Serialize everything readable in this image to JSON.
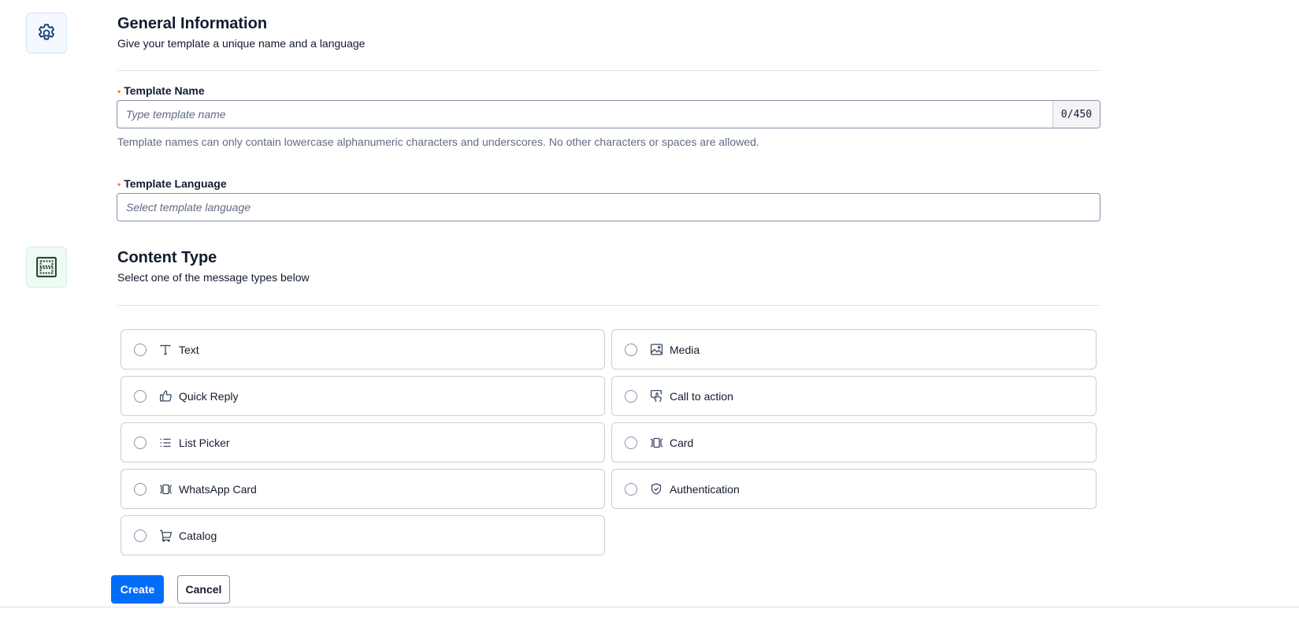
{
  "general": {
    "title": "General Information",
    "subtitle": "Give your template a unique name and a language",
    "icon": "gear-icon"
  },
  "template_name": {
    "required_marker": "•",
    "label": "Template Name",
    "placeholder": "Type template name",
    "value": "",
    "counter": "0/450",
    "help": "Template names can only contain lowercase alphanumeric characters and underscores. No other characters or spaces are allowed."
  },
  "template_language": {
    "required_marker": "•",
    "label": "Template Language",
    "placeholder": "Select template language"
  },
  "content_type": {
    "title": "Content Type",
    "subtitle": "Select one of the message types below",
    "icon": "content-layout-icon",
    "options": [
      {
        "label": "Text",
        "icon": "text-icon"
      },
      {
        "label": "Media",
        "icon": "image-icon"
      },
      {
        "label": "Quick Reply",
        "icon": "thumbs-up-icon"
      },
      {
        "label": "Call to action",
        "icon": "tap-icon"
      },
      {
        "label": "List Picker",
        "icon": "list-icon"
      },
      {
        "label": "Card",
        "icon": "card-icon"
      },
      {
        "label": "WhatsApp Card",
        "icon": "card-icon"
      },
      {
        "label": "Authentication",
        "icon": "shield-check-icon"
      },
      {
        "label": "Catalog",
        "icon": "cart-icon"
      }
    ]
  },
  "actions": {
    "create_label": "Create",
    "cancel_label": "Cancel"
  },
  "colors": {
    "primary": "#006dfa",
    "required": "#f47c22",
    "text": "#121c2d",
    "muted": "#606b85",
    "border": "#cacdd8"
  }
}
